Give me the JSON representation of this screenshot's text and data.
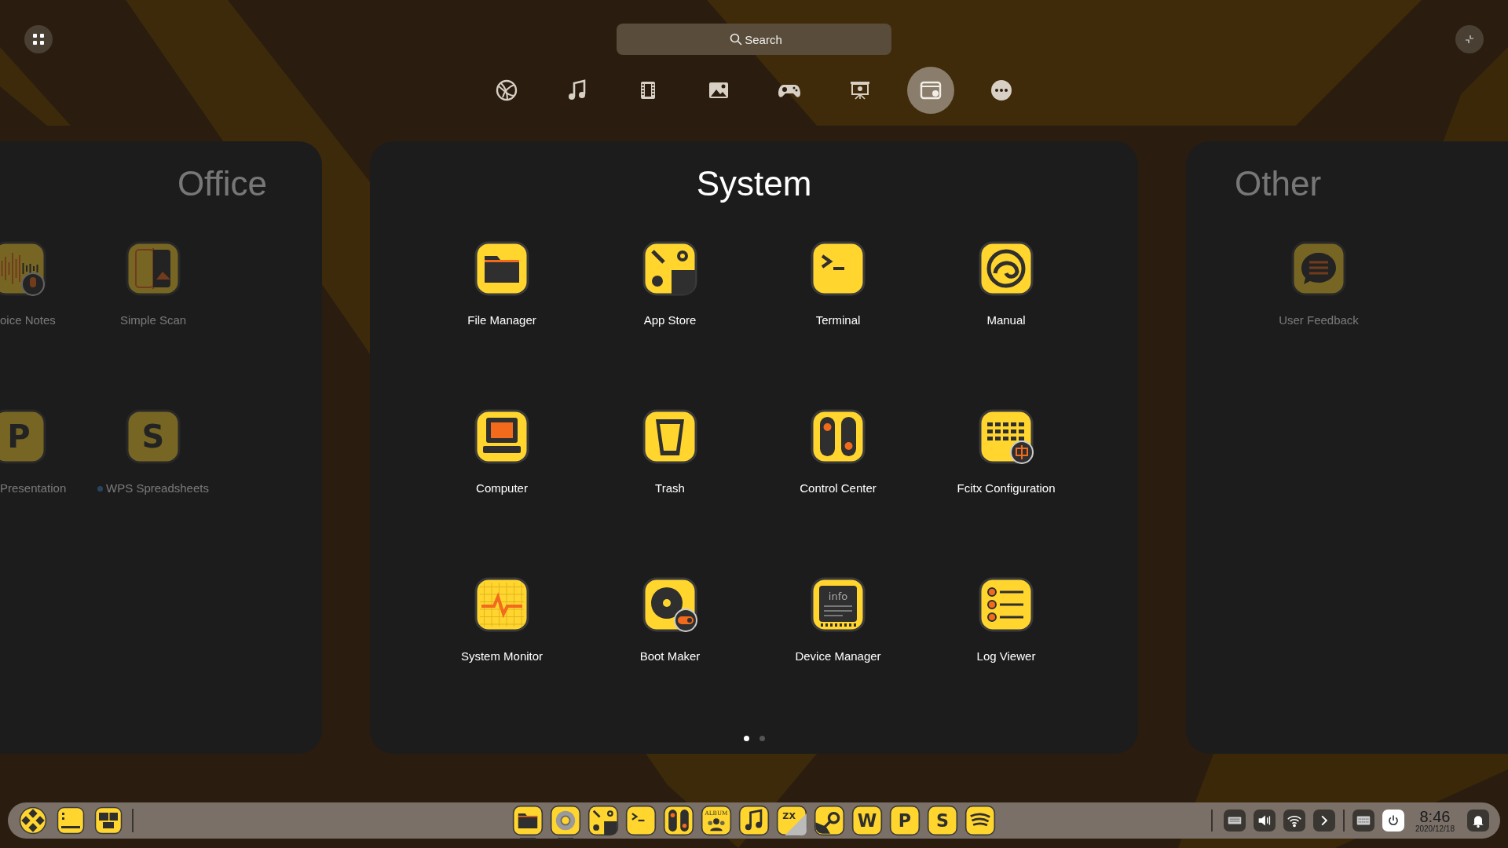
{
  "search": {
    "placeholder": "Search"
  },
  "categories": [
    {
      "kind": "internet",
      "selected": false
    },
    {
      "kind": "music",
      "selected": false
    },
    {
      "kind": "video",
      "selected": false
    },
    {
      "kind": "image",
      "selected": false
    },
    {
      "kind": "game",
      "selected": false
    },
    {
      "kind": "office",
      "selected": false
    },
    {
      "kind": "system",
      "selected": true
    },
    {
      "kind": "other",
      "selected": false
    }
  ],
  "panels": [
    {
      "title": "Office",
      "selected": false,
      "apps": [
        {
          "label": "oice Notes",
          "kind": "voice",
          "new": false
        },
        {
          "label": "Simple Scan",
          "kind": "scan",
          "new": false
        },
        {
          "label": "Presentation",
          "kind": "letter",
          "glyph": "P",
          "new": false
        },
        {
          "label": "WPS Spreadsheets",
          "kind": "letter",
          "glyph": "S",
          "new": true
        }
      ]
    },
    {
      "title": "System",
      "selected": true,
      "apps": [
        {
          "label": "File Manager",
          "kind": "folder",
          "new": false
        },
        {
          "label": "App Store",
          "kind": "appstore",
          "new": false
        },
        {
          "label": "Terminal",
          "kind": "terminal",
          "new": false
        },
        {
          "label": "Manual",
          "kind": "manual",
          "new": false
        },
        {
          "label": "Computer",
          "kind": "computer",
          "new": false
        },
        {
          "label": "Trash",
          "kind": "trash",
          "new": false
        },
        {
          "label": "Control Center",
          "kind": "control",
          "new": false
        },
        {
          "label": "Fcitx Configuration",
          "kind": "keyboard",
          "new": false
        },
        {
          "label": "System Monitor",
          "kind": "monitor",
          "new": false
        },
        {
          "label": "Boot Maker",
          "kind": "bootmaker",
          "new": false
        },
        {
          "label": "Device Manager",
          "kind": "info",
          "glyph": "info",
          "new": false
        },
        {
          "label": "Log Viewer",
          "kind": "logviewer",
          "new": false
        }
      ],
      "page_dots": [
        {
          "selected": true
        },
        {
          "selected": false
        }
      ]
    },
    {
      "title": "Other",
      "selected": false,
      "apps": [
        {
          "label": "User Feedback",
          "kind": "feedback",
          "new": false
        }
      ]
    }
  ],
  "taskbar": {
    "left": [
      {
        "kind": "launcher"
      },
      {
        "kind": "desktop"
      },
      {
        "kind": "multitask"
      }
    ],
    "apps": [
      {
        "kind": "folder",
        "running": true
      },
      {
        "kind": "browser",
        "running": true
      },
      {
        "kind": "appstore",
        "running": false
      },
      {
        "kind": "terminal",
        "running": false
      },
      {
        "kind": "control",
        "running": false
      },
      {
        "kind": "album",
        "glyph": "ALBUM",
        "running": false
      },
      {
        "kind": "music",
        "running": false
      },
      {
        "kind": "archive",
        "glyph": "ZX",
        "running": false
      },
      {
        "kind": "steam",
        "running": false
      },
      {
        "kind": "letter",
        "glyph": "W",
        "running": false
      },
      {
        "kind": "letter",
        "glyph": "P",
        "running": false
      },
      {
        "kind": "letter",
        "glyph": "S",
        "running": false
      },
      {
        "kind": "stream",
        "running": false
      }
    ],
    "tray": [
      {
        "kind": "keyboard"
      },
      {
        "kind": "volume"
      },
      {
        "kind": "wifi"
      },
      {
        "kind": "chevron"
      },
      {
        "kind": "divider"
      },
      {
        "kind": "ime"
      },
      {
        "kind": "power"
      }
    ],
    "clock": {
      "time": "8:46",
      "date": "2020/12/18"
    }
  }
}
